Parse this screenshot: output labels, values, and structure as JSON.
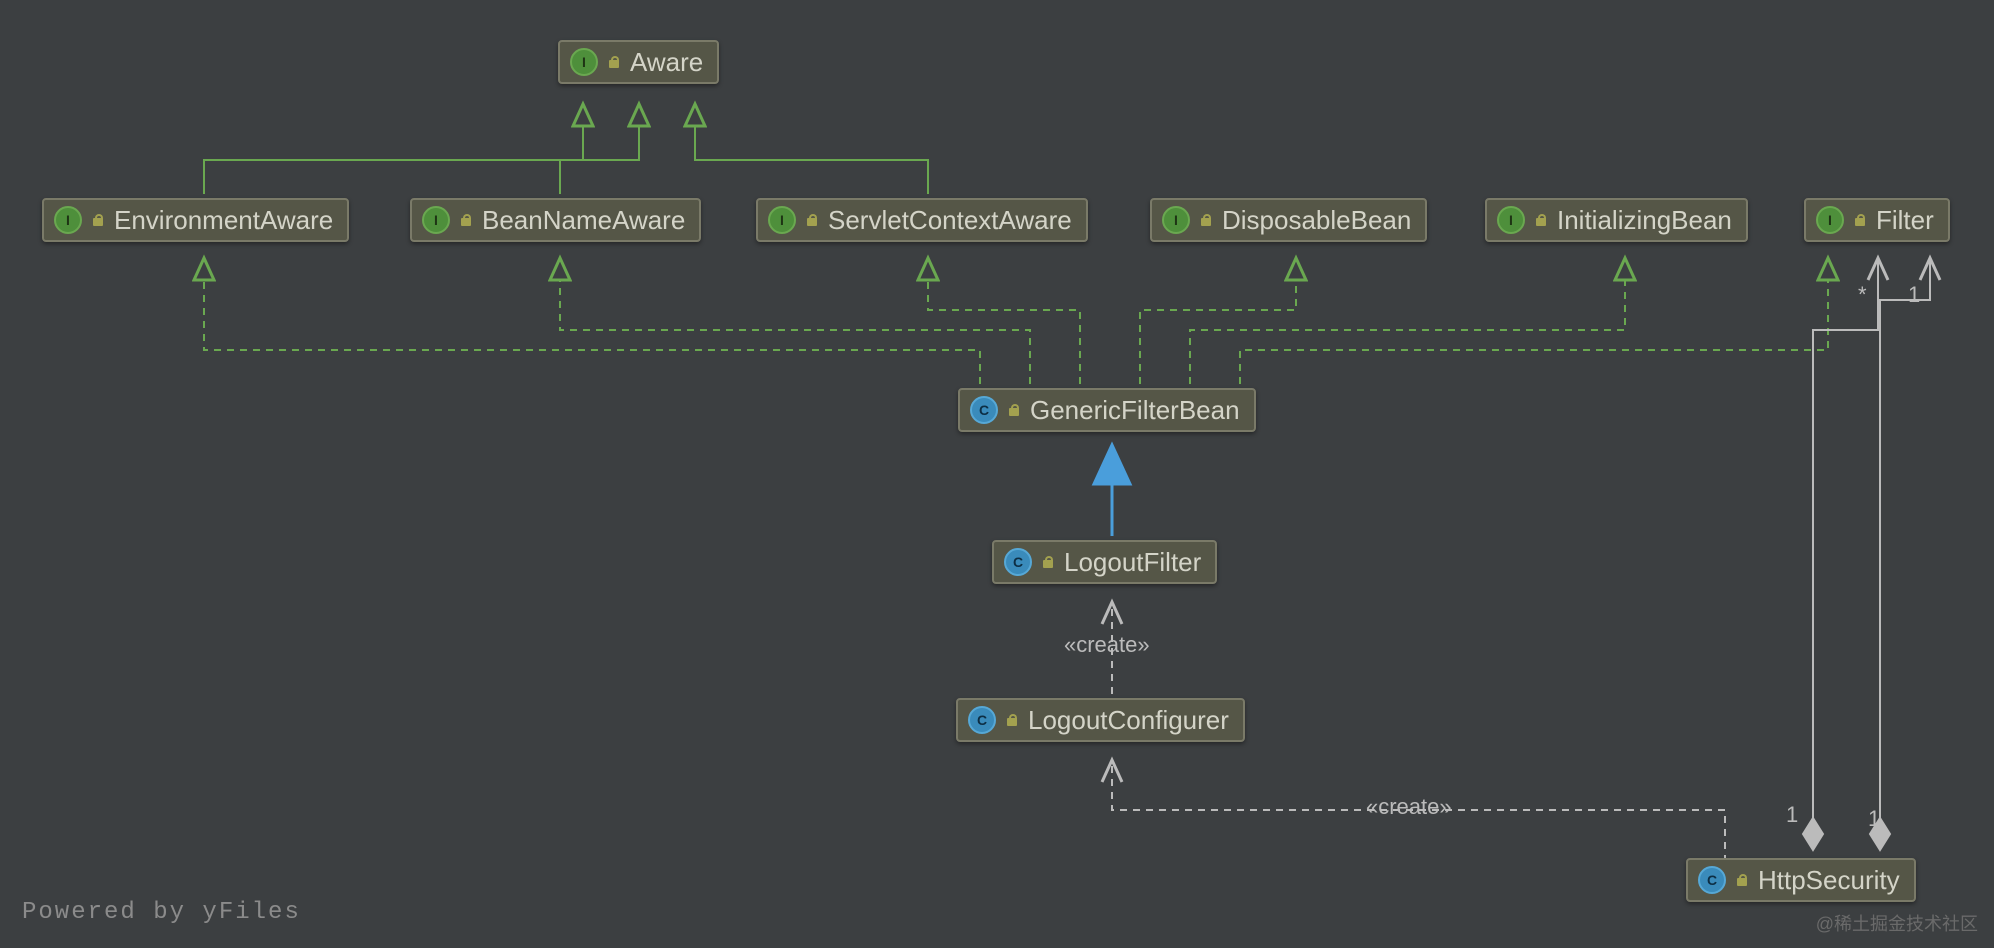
{
  "nodes": {
    "aware": {
      "label": "Aware",
      "kind": "interface"
    },
    "environmentAware": {
      "label": "EnvironmentAware",
      "kind": "interface"
    },
    "beanNameAware": {
      "label": "BeanNameAware",
      "kind": "interface"
    },
    "servletContextAware": {
      "label": "ServletContextAware",
      "kind": "interface"
    },
    "disposableBean": {
      "label": "DisposableBean",
      "kind": "interface"
    },
    "initializingBean": {
      "label": "InitializingBean",
      "kind": "interface"
    },
    "filter": {
      "label": "Filter",
      "kind": "interface"
    },
    "genericFilterBean": {
      "label": "GenericFilterBean",
      "kind": "class"
    },
    "logoutFilter": {
      "label": "LogoutFilter",
      "kind": "class"
    },
    "logoutConfigurer": {
      "label": "LogoutConfigurer",
      "kind": "class"
    },
    "httpSecurity": {
      "label": "HttpSecurity",
      "kind": "class"
    }
  },
  "labels": {
    "create1": "«create»",
    "create2": "«create»",
    "multStar": "*",
    "mult1a": "1",
    "mult1b": "1",
    "mult1c": "1"
  },
  "footer": {
    "left": "Powered by yFiles",
    "right": "@稀土掘金技术社区"
  },
  "colors": {
    "bg": "#3c3f41",
    "nodeFill": "#555647",
    "green": "#6aa850",
    "blue": "#4a9edb",
    "gray": "#bbbbbb"
  },
  "chart_data": {
    "type": "uml-class-diagram",
    "nodes": [
      {
        "id": "Aware",
        "stereotype": "interface"
      },
      {
        "id": "EnvironmentAware",
        "stereotype": "interface"
      },
      {
        "id": "BeanNameAware",
        "stereotype": "interface"
      },
      {
        "id": "ServletContextAware",
        "stereotype": "interface"
      },
      {
        "id": "DisposableBean",
        "stereotype": "interface"
      },
      {
        "id": "InitializingBean",
        "stereotype": "interface"
      },
      {
        "id": "Filter",
        "stereotype": "interface"
      },
      {
        "id": "GenericFilterBean",
        "stereotype": "class"
      },
      {
        "id": "LogoutFilter",
        "stereotype": "class"
      },
      {
        "id": "LogoutConfigurer",
        "stereotype": "class"
      },
      {
        "id": "HttpSecurity",
        "stereotype": "class"
      }
    ],
    "edges": [
      {
        "from": "EnvironmentAware",
        "to": "Aware",
        "relation": "extends",
        "style": "solid-triangle-green"
      },
      {
        "from": "BeanNameAware",
        "to": "Aware",
        "relation": "extends",
        "style": "solid-triangle-green"
      },
      {
        "from": "ServletContextAware",
        "to": "Aware",
        "relation": "extends",
        "style": "solid-triangle-green"
      },
      {
        "from": "GenericFilterBean",
        "to": "EnvironmentAware",
        "relation": "implements",
        "style": "dashed-triangle-green"
      },
      {
        "from": "GenericFilterBean",
        "to": "BeanNameAware",
        "relation": "implements",
        "style": "dashed-triangle-green"
      },
      {
        "from": "GenericFilterBean",
        "to": "ServletContextAware",
        "relation": "implements",
        "style": "dashed-triangle-green"
      },
      {
        "from": "GenericFilterBean",
        "to": "DisposableBean",
        "relation": "implements",
        "style": "dashed-triangle-green"
      },
      {
        "from": "GenericFilterBean",
        "to": "InitializingBean",
        "relation": "implements",
        "style": "dashed-triangle-green"
      },
      {
        "from": "GenericFilterBean",
        "to": "Filter",
        "relation": "implements",
        "style": "dashed-triangle-green"
      },
      {
        "from": "LogoutFilter",
        "to": "GenericFilterBean",
        "relation": "extends",
        "style": "solid-triangle-blue"
      },
      {
        "from": "LogoutConfigurer",
        "to": "LogoutFilter",
        "relation": "dependency",
        "label": "«create»",
        "style": "dashed-open-gray"
      },
      {
        "from": "HttpSecurity",
        "to": "LogoutConfigurer",
        "relation": "dependency",
        "label": "«create»",
        "style": "dashed-open-gray"
      },
      {
        "from": "HttpSecurity",
        "to": "Filter",
        "relation": "aggregation",
        "multiplicity_from": "1",
        "multiplicity_to": "*",
        "style": "solid-diamond-gray"
      },
      {
        "from": "HttpSecurity",
        "to": "Filter",
        "relation": "aggregation",
        "multiplicity_from": "1",
        "multiplicity_to": "1",
        "style": "solid-diamond-gray"
      }
    ]
  }
}
